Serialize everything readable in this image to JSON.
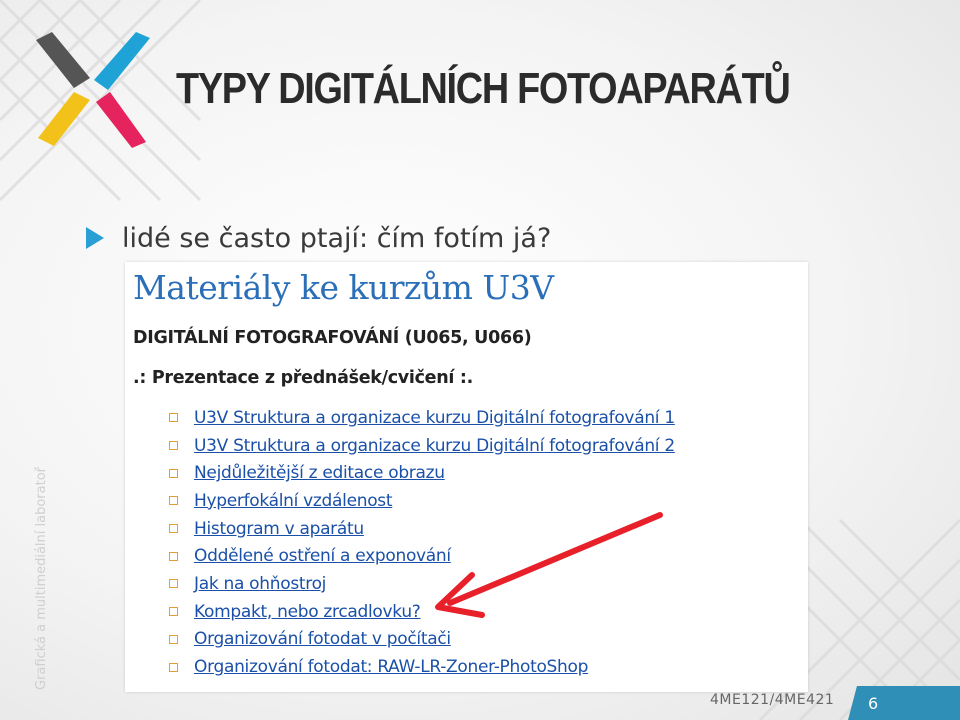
{
  "slide": {
    "title": "TYPY DIGITÁLNÍCH FOTOAPARÁTŮ",
    "bullet": "lidé se často ptají: čím fotím já?",
    "side_text": "Grafická a multimediální laboratoř",
    "footer_code": "4ME121/4ME421",
    "page_number": "6"
  },
  "screenshot": {
    "heading": "Materiály ke kurzům U3V",
    "course": "DIGITÁLNÍ FOTOGRAFOVÁNÍ (U065, U066)",
    "subheading": ".: Prezentace z přednášek/cvičení :.",
    "links": [
      "U3V Struktura a organizace kurzu Digitální fotografování 1",
      "U3V Struktura a organizace kurzu Digitální fotografování 2",
      "Nejdůležitější z editace obrazu",
      "Hyperfokální vzdálenost",
      "Histogram v aparátu",
      "Oddělené ostření a exponování",
      "Jak na ohňostroj",
      "Kompakt, nebo zrcadlovku?",
      "Organizování fotodat v počítači",
      "Organizování fotodat: RAW-LR-Zoner-PhotoShop"
    ]
  },
  "icons": {
    "logo": "x-logo-icon",
    "bullet": "triangle-bullet-icon",
    "link_bullet": "square-bullet-icon",
    "annotation": "red-arrow-icon"
  },
  "colors": {
    "title": "#2b2b2b",
    "heading_blue": "#2a6fb8",
    "link_blue": "#1a50a8",
    "accent_teal": "#2f8fb7",
    "arrow_red": "#e8202a",
    "logo_yellow": "#f2c21a",
    "logo_cyan": "#1fa3d6",
    "logo_magenta": "#e5245e",
    "logo_gray": "#555555"
  }
}
